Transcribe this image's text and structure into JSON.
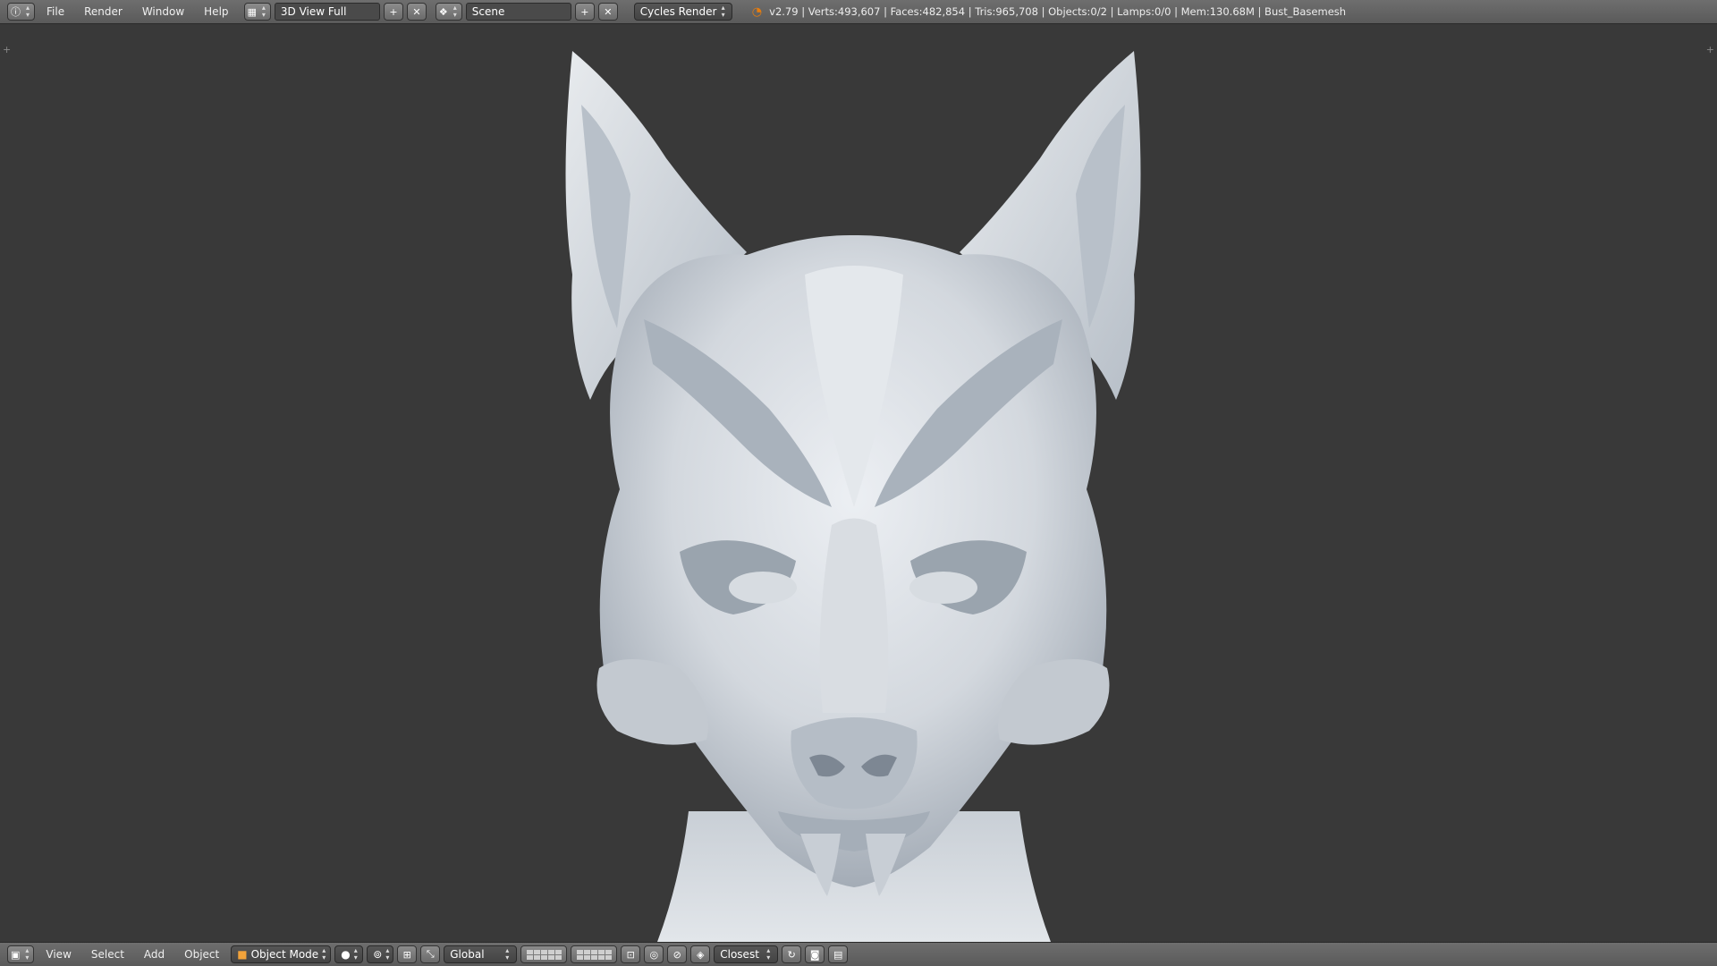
{
  "topbar": {
    "info_icon": "info-icon",
    "menus": [
      "File",
      "Render",
      "Window",
      "Help"
    ],
    "screen_layout": "3D View Full",
    "scene": "Scene",
    "render_engine": "Cycles Render",
    "stats": "v2.79 | Verts:493,607 | Faces:482,854 | Tris:965,708 | Objects:0/2 | Lamps:0/0 | Mem:130.68M | Bust_Basemesh"
  },
  "bottombar": {
    "menus": [
      "View",
      "Select",
      "Add",
      "Object"
    ],
    "mode": "Object Mode",
    "transform_orientation": "Global",
    "snap_element": "Closest"
  },
  "colors": {
    "viewport_bg": "#393939",
    "header_bg": "#5f5f5f",
    "model_light": "#e6e9ed",
    "model_shadow": "#8a95a3",
    "blender_orange": "#e87d0d"
  }
}
